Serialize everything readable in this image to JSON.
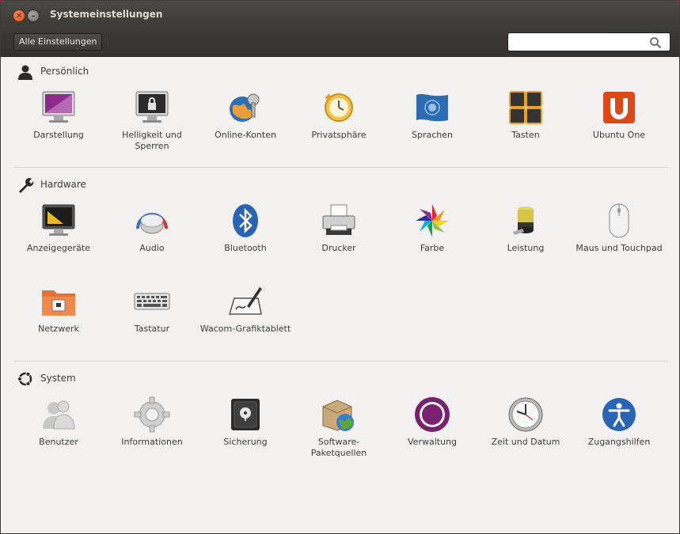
{
  "window": {
    "title": "Systemeinstellungen"
  },
  "toolbar": {
    "all_settings": "Alle Einstellungen",
    "search_placeholder": "",
    "search_value": ""
  },
  "sections": {
    "personal": {
      "title": "Persönlich",
      "items": [
        "Darstellung",
        "Helligkeit und Sperren",
        "Online-Konten",
        "Privatsphäre",
        "Sprachen",
        "Tasten",
        "Ubuntu One"
      ]
    },
    "hardware": {
      "title": "Hardware",
      "items": [
        "Anzeigegeräte",
        "Audio",
        "Bluetooth",
        "Drucker",
        "Farbe",
        "Leistung",
        "Maus und Touchpad",
        "Netzwerk",
        "Tastatur",
        "Wacom-Grafiktablett"
      ]
    },
    "system": {
      "title": "System",
      "items": [
        "Benutzer",
        "Informationen",
        "Sicherung",
        "Software-Paketquellen",
        "Verwaltung",
        "Zeit und Datum",
        "Zugangshilfen"
      ]
    }
  },
  "colors": {
    "ubuntu_orange": "#dd4814",
    "aubergine": "#77216f",
    "titlebar": "#3c3b37"
  }
}
